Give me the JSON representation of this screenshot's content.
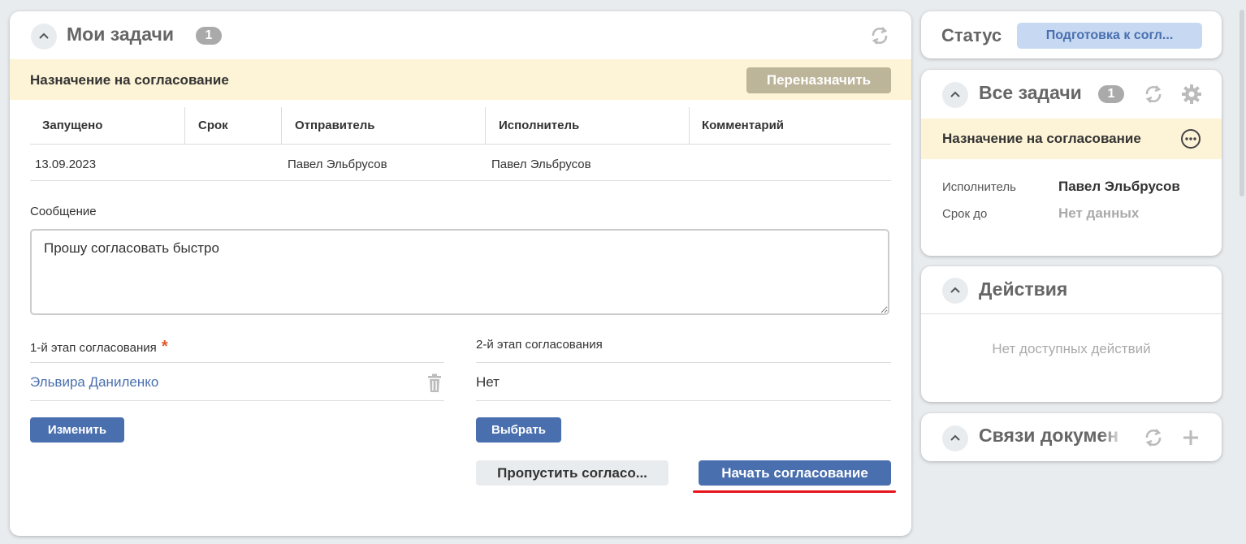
{
  "my_tasks": {
    "title": "Мои задачи",
    "count": "1",
    "task_title": "Назначение на согласование",
    "reassign_label": "Переназначить",
    "table": {
      "headers": [
        "Запущено",
        "Срок",
        "Отправитель",
        "Исполнитель",
        "Комментарий"
      ],
      "row": [
        "13.09.2023",
        "",
        "Павел Эльбрусов",
        "Павел Эльбрусов",
        ""
      ]
    },
    "message_label": "Сообщение",
    "message_value": "Прошу согласовать быстро",
    "stage1_label": "1-й этап согласования",
    "required_mark": "*",
    "stage1_value": "Эльвира Даниленко",
    "stage2_label": "2-й этап согласования",
    "stage2_value": "Нет",
    "change_label": "Изменить",
    "choose_label": "Выбрать",
    "skip_label": "Пропустить согласо...",
    "start_label": "Начать согласование"
  },
  "status": {
    "label": "Статус",
    "value": "Подготовка к согл..."
  },
  "all_tasks": {
    "title": "Все задачи",
    "count": "1",
    "task_title": "Назначение на согласование",
    "executor_label": "Исполнитель",
    "executor_value": "Павел Эльбрусов",
    "due_label": "Срок до",
    "due_value": "Нет данных"
  },
  "actions": {
    "title": "Действия",
    "empty": "Нет доступных действий"
  },
  "links": {
    "title": "Связи докумен"
  },
  "icons": {
    "collapse": "chevron-up-icon",
    "refresh": "refresh-icon",
    "settings": "gear-icon",
    "more": "more-dots-icon",
    "delete": "trash-icon",
    "add": "plus-icon",
    "resize": "resize-grip-icon"
  },
  "colors": {
    "primary": "#4a6fae",
    "band": "#fdf3d6",
    "disabled": "#bdb59a",
    "status_badge": "#c6d8f2",
    "required": "#e2552b",
    "link": "#4a6fae",
    "underline": "#e8141c"
  }
}
